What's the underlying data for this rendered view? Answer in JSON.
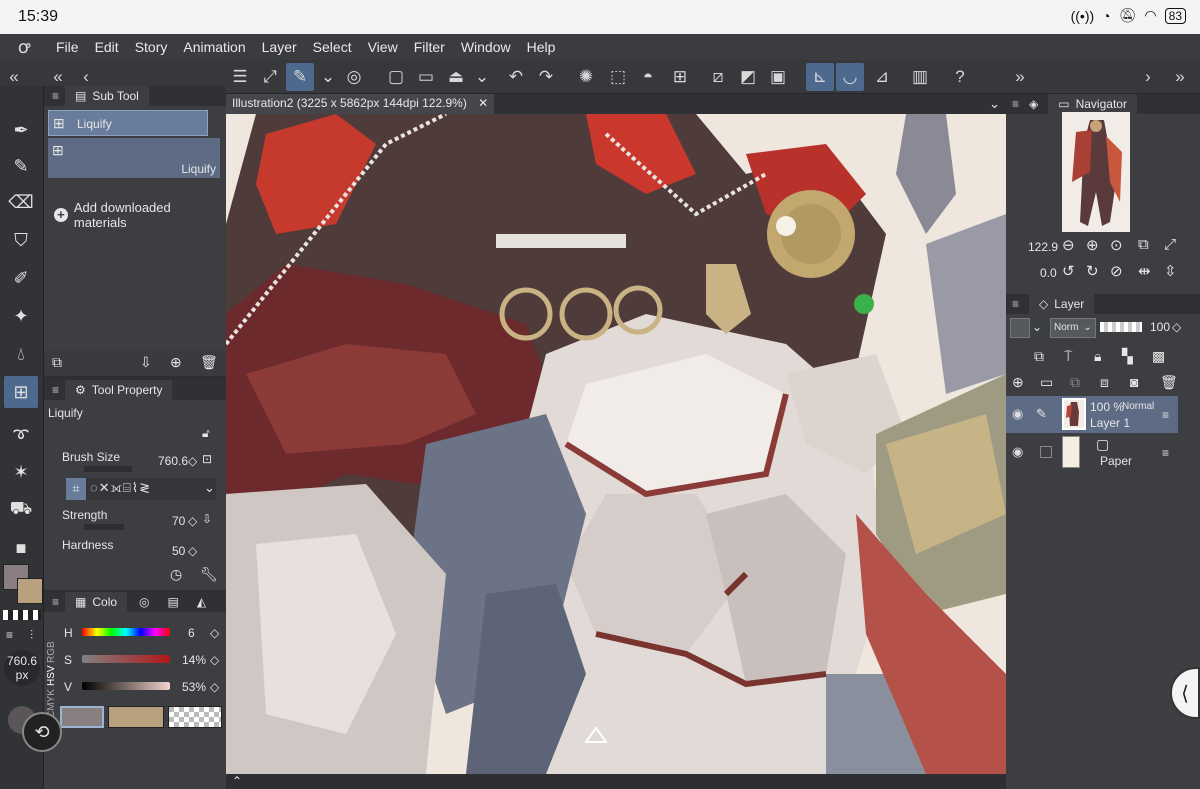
{
  "status_bar": {
    "time": "15:39",
    "battery": "83"
  },
  "menu": [
    "File",
    "Edit",
    "Story",
    "Animation",
    "Layer",
    "Select",
    "View",
    "Filter",
    "Window",
    "Help"
  ],
  "subtool_panel": {
    "title": "Sub Tool",
    "items": [
      {
        "label": "Liquify",
        "selected": true
      },
      {
        "label": "Liquify",
        "selected": false
      }
    ],
    "add_materials": "Add downloaded materials"
  },
  "tool_property": {
    "title": "Tool Property",
    "tool_name": "Liquify",
    "brush_size_label": "Brush Size",
    "brush_size_value": "760.6",
    "strength_label": "Strength",
    "strength_value": "70",
    "hardness_label": "Hardness",
    "hardness_value": "50"
  },
  "color_panel": {
    "title": "Colo",
    "mode_labels": [
      "CMYK",
      "HSV",
      "RGB"
    ],
    "h_label": "H",
    "h_value": "6",
    "s_label": "S",
    "s_value": "14%",
    "v_label": "V",
    "v_value": "53%",
    "main_color": "#8a7f80",
    "sub_color": "#b9a07f"
  },
  "brush_size_indicator": {
    "value": "760.6",
    "unit": "px"
  },
  "document_tab": {
    "title": "Illustration2 (3225 x 5862px 144dpi 122.9%)"
  },
  "navigator": {
    "title": "Navigator",
    "zoom": "122.9",
    "rotation": "0.0"
  },
  "layer_panel": {
    "title": "Layer",
    "blend_mode": "Norm",
    "opacity": "100",
    "layers": [
      {
        "opacity": "100 %",
        "mode": "Normal",
        "name": "Layer 1",
        "selected": true
      },
      {
        "opacity": "",
        "mode": "",
        "name": "Paper",
        "selected": false
      }
    ]
  },
  "colors": {
    "accent": "#4d6a8e",
    "panel": "#3c3e42",
    "dark": "#2d2f33"
  }
}
